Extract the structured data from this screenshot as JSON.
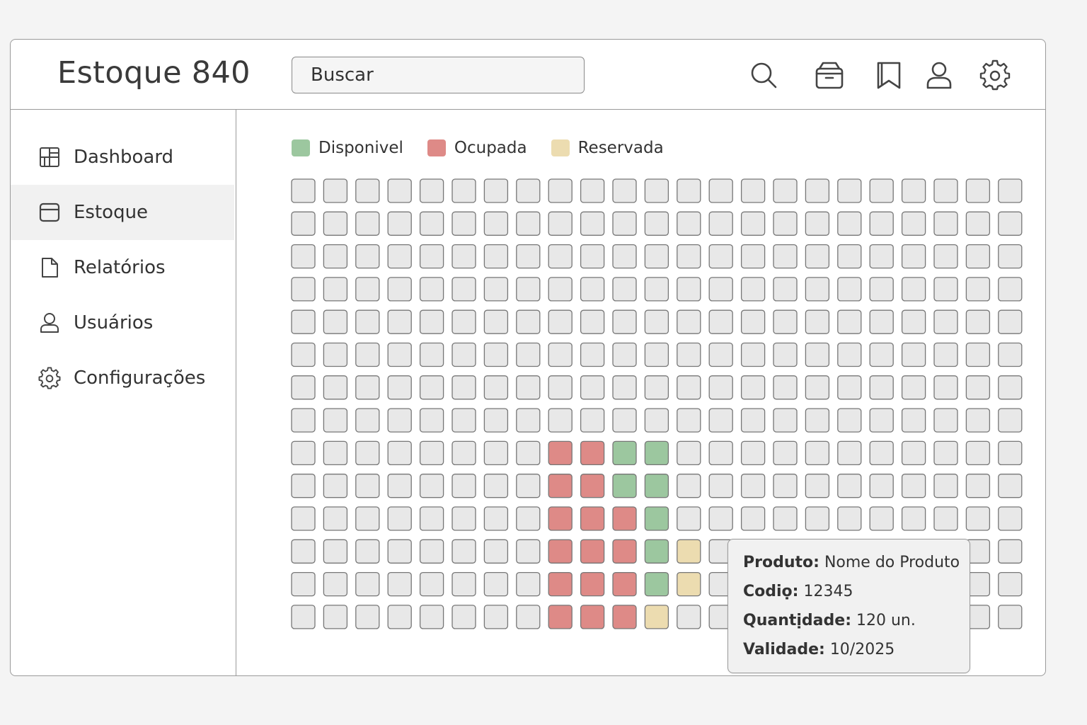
{
  "app": {
    "title": "Estoque 840"
  },
  "search": {
    "placeholder": "Buscar"
  },
  "header_icons": [
    "search-icon",
    "archive-box-icon",
    "bookmarks-icon",
    "user-icon",
    "gear-icon"
  ],
  "sidebar": {
    "items": [
      {
        "label": "Dashboard",
        "icon": "dashboard-grid-icon",
        "active": false
      },
      {
        "label": "Estoque",
        "icon": "window-box-icon",
        "active": true
      },
      {
        "label": "Relatórios",
        "icon": "document-icon",
        "active": false
      },
      {
        "label": "Usuários",
        "icon": "user-icon",
        "active": false
      },
      {
        "label": "Configurações",
        "icon": "gear-icon",
        "active": false
      }
    ]
  },
  "legend": [
    {
      "label": "Disponivel",
      "color": "#9cc79f"
    },
    {
      "label": "Ocupada",
      "color": "#de8a87"
    },
    {
      "label": "Reservada",
      "color": "#ecdcb0"
    }
  ],
  "colors": {
    "empty": "#e8e8e8",
    "available": "#9cc79f",
    "occupied": "#de8a87",
    "reserved": "#ecdcb0"
  },
  "grid": {
    "rows": 14,
    "cols": 23,
    "cells": {
      "8": {
        "8": "occupied",
        "9": "occupied",
        "10": "available",
        "11": "available"
      },
      "9": {
        "8": "occupied",
        "9": "occupied",
        "10": "available",
        "11": "available"
      },
      "10": {
        "8": "occupied",
        "9": "occupied",
        "10": "occupied",
        "11": "available"
      },
      "11": {
        "8": "occupied",
        "9": "occupied",
        "10": "occupied",
        "11": "available",
        "12": "reserved"
      },
      "12": {
        "8": "occupied",
        "9": "occupied",
        "10": "occupied",
        "11": "available",
        "12": "reserved"
      },
      "13": {
        "8": "occupied",
        "9": "occupied",
        "10": "occupied",
        "11": "reserved"
      }
    }
  },
  "tooltip": {
    "product_key": "Produto:",
    "product_value": "Nome do Produto",
    "code_key": "Codiọ:",
    "code_value": "12345",
    "qty_key": "Quantịdade:",
    "qty_value": "120 un.",
    "validity_key": "Validade:",
    "validity_value": "10/2025"
  }
}
